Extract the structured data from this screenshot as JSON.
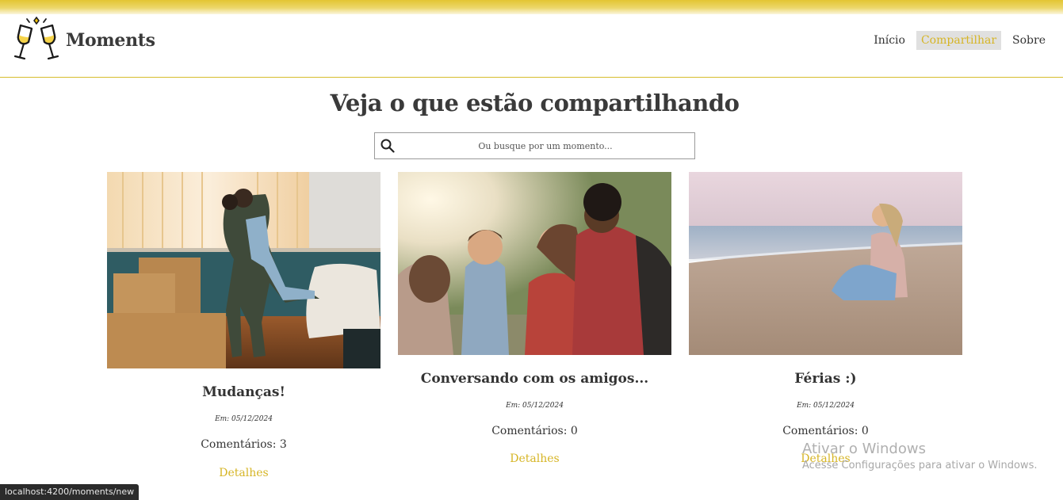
{
  "app": {
    "brand": "Moments"
  },
  "nav": {
    "items": [
      {
        "label": "Início",
        "active": false
      },
      {
        "label": "Compartilhar",
        "active": true
      },
      {
        "label": "Sobre",
        "active": false
      }
    ]
  },
  "main": {
    "title": "Veja o que estão compartilhando",
    "search": {
      "placeholder": "Ou busque por um momento...",
      "value": ""
    }
  },
  "moments": [
    {
      "title": "Mudanças!",
      "date": "Em: 05/12/2024",
      "comments": "Comentários: 3",
      "link": "Detalhes",
      "image": "couple-moving-boxes"
    },
    {
      "title": "Conversando com os amigos...",
      "date": "Em: 05/12/2024",
      "comments": "Comentários: 0",
      "link": "Detalhes",
      "image": "friends-outdoors"
    },
    {
      "title": "Férias :)",
      "date": "Em: 05/12/2024",
      "comments": "Comentários: 0",
      "link": "Detalhes",
      "image": "woman-on-beach"
    }
  ],
  "overlay": {
    "activation_title": "Ativar o Windows",
    "activation_sub": "Acesse Configurações para ativar o Windows."
  },
  "status_url": "localhost:4200/moments/new",
  "colors": {
    "accent": "#d6b526",
    "top_bar": "#e3c532",
    "text": "#333333",
    "active_nav_bg": "#e0e0e0"
  }
}
